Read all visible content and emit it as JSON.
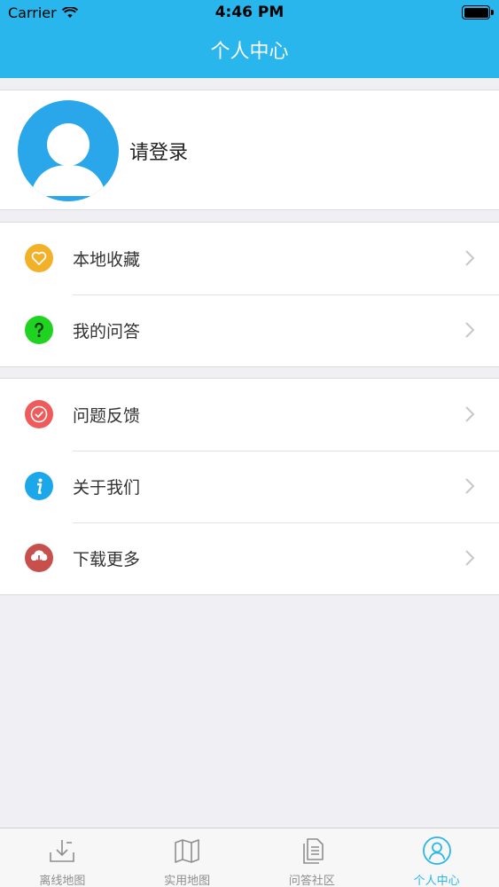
{
  "status_bar": {
    "carrier": "Carrier",
    "time": "4:46 PM"
  },
  "nav": {
    "title": "个人中心"
  },
  "profile": {
    "login_text": "请登录"
  },
  "menu_group_1": [
    {
      "label": "本地收藏",
      "icon": "heart-icon",
      "color": "#f3b12a"
    },
    {
      "label": "我的问答",
      "icon": "question-icon",
      "color": "#21d321"
    }
  ],
  "menu_group_2": [
    {
      "label": "问题反馈",
      "icon": "check-circle-icon",
      "color": "#ef5b5b"
    },
    {
      "label": "关于我们",
      "icon": "info-icon",
      "color": "#1ba7ea"
    },
    {
      "label": "下载更多",
      "icon": "download-cloud-icon",
      "color": "#c8504c"
    }
  ],
  "tabbar": [
    {
      "label": "离线地图",
      "icon": "download-tray-icon",
      "active": false
    },
    {
      "label": "实用地图",
      "icon": "map-icon",
      "active": false
    },
    {
      "label": "问答社区",
      "icon": "documents-icon",
      "active": false
    },
    {
      "label": "个人中心",
      "icon": "user-circle-icon",
      "active": true
    }
  ],
  "colors": {
    "brand": "#29b6ec",
    "background": "#efeff4"
  }
}
